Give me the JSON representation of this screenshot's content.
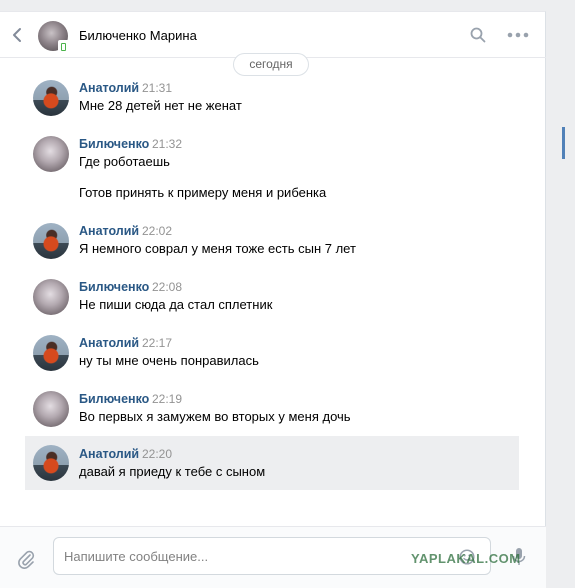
{
  "header": {
    "contact_name": "Билюченко Марина"
  },
  "date_divider": "сегодня",
  "messages": [
    {
      "author": "Анатолий",
      "time": "21:31",
      "lines": [
        "Мне 28 детей нет не женат"
      ]
    },
    {
      "author": "Билюченко",
      "time": "21:32",
      "lines": [
        "Где роботаешь",
        "Готов принять к примеру меня и рибенка"
      ]
    },
    {
      "author": "Анатолий",
      "time": "22:02",
      "lines": [
        "Я немного соврал у меня тоже есть сын 7 лет"
      ]
    },
    {
      "author": "Билюченко",
      "time": "22:08",
      "lines": [
        "Не пиши сюда да стал сплетник"
      ]
    },
    {
      "author": "Анатолий",
      "time": "22:17",
      "lines": [
        "ну ты мне очень понравилась"
      ]
    },
    {
      "author": "Билюченко",
      "time": "22:19",
      "lines": [
        "Во первых я замужем во вторых у меня дочь"
      ]
    },
    {
      "author": "Анатолий",
      "time": "22:20",
      "lines": [
        "давай я приеду к тебе с сыном"
      ],
      "highlighted": true
    }
  ],
  "composer": {
    "placeholder": "Напишите сообщение..."
  },
  "watermark": "YAPLAKAL.COM",
  "icons": {
    "back": "chevron-left-icon",
    "search": "search-icon",
    "more": "more-icon",
    "attach": "paperclip-icon",
    "emoji": "emoji-icon",
    "mic": "microphone-icon",
    "online": "mobile-online-icon"
  },
  "colors": {
    "author_name": "#2a5885",
    "timestamp": "#939393",
    "highlight_bg": "#edeef0",
    "accent": "#5181b8"
  }
}
